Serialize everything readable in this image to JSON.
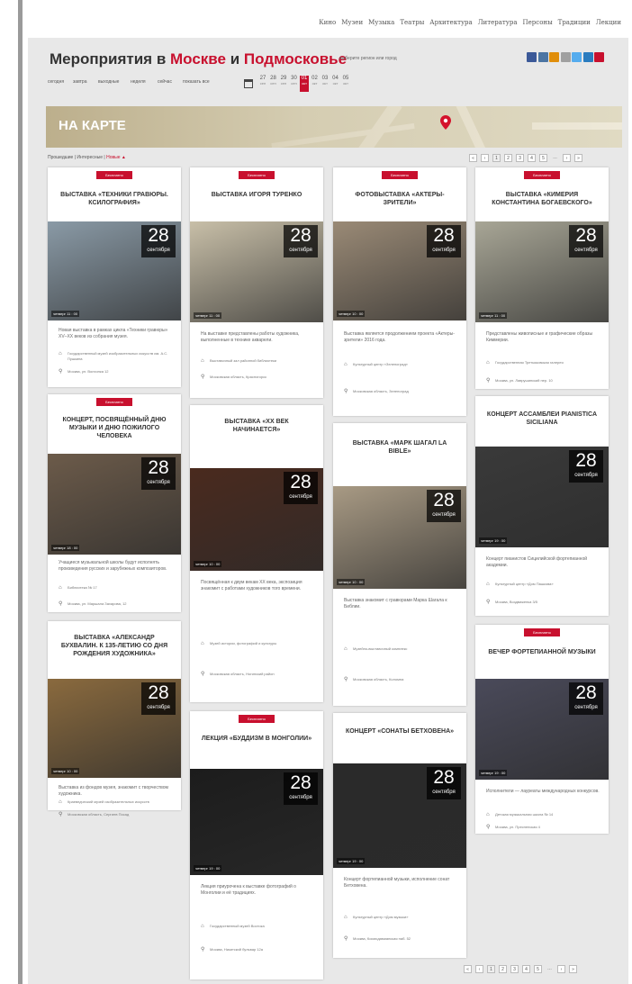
{
  "nav": {
    "items": [
      "Кино",
      "Музеи",
      "Музыка",
      "Театры",
      "Архитектура",
      "Литература",
      "Персоны",
      "Традиции",
      "Лекции"
    ]
  },
  "header": {
    "title_part1": "Мероприятия в",
    "title_city": "Москве",
    "title_and": "и",
    "title_region": "Подмосковье",
    "subtitle": "выберите регион или город"
  },
  "share_colors": [
    "#3b5998",
    "#4c75a3",
    "#e08e0b",
    "#a0a0a0",
    "#55acee",
    "#2a7cbf",
    "#c8102e"
  ],
  "date_bar": {
    "day_links": [
      "сегодня",
      "завтра",
      "выходные",
      "неделя",
      "сейчас",
      "показать все"
    ],
    "dates": [
      {
        "num": "27",
        "mon": "сен"
      },
      {
        "num": "28",
        "mon": "сен"
      },
      {
        "num": "29",
        "mon": "сен"
      },
      {
        "num": "30",
        "mon": "сен"
      },
      {
        "num": "01",
        "mon": "окт"
      },
      {
        "num": "02",
        "mon": "окт"
      },
      {
        "num": "03",
        "mon": "окт"
      },
      {
        "num": "04",
        "mon": "окт"
      },
      {
        "num": "05",
        "mon": "окт"
      }
    ],
    "active_index": 4
  },
  "map_banner": {
    "label": "НА КАРТЕ"
  },
  "filters": {
    "options": [
      "Прошедшие",
      "Интересные",
      "Новые"
    ],
    "active_index": 2
  },
  "pagination": {
    "items": [
      "«",
      "‹",
      "1",
      "2",
      "3",
      "4",
      "5",
      "…",
      "›",
      "»"
    ],
    "active_index": 2
  },
  "columns": [
    [
      {
        "badge": "Бесплатно",
        "title": "Выставка «Техники гравюры. Ксилография»",
        "day": "28",
        "month": "сентября",
        "time": "четверг 11 : 00",
        "desc": "Новая выставка в рамках цикла «Техники гравюры» XV–XX веков из собрания музея.",
        "place": "Государственный музей изобразительных искусств им. А.С. Пушкина",
        "address": "Москва, ул. Волхонка 12",
        "photo": "#8a9aa6"
      },
      {
        "badge": "Бесплатно",
        "title": "Концерт, посвящённый Дню музыки и Дню пожилого человека",
        "day": "28",
        "month": "сентября",
        "time": "четверг 18 : 00",
        "desc": "Учащиеся музыкальной школы будут исполнять произведения русских и зарубежных композиторов.",
        "place": "Библиотека № 17",
        "address": "Москва, ул. Маршала Захарова, 12",
        "photo": "#6c5b4a"
      },
      {
        "badge": "",
        "title": "Выставка «Александр Бухвалин. К 135-летию со дня рождения художника»",
        "day": "28",
        "month": "сентября",
        "time": "четверг 10 : 00",
        "desc": "Выставка из фондов музея, знакомит с творчеством художника.",
        "place": "Краеведческий музей изобразительных искусств",
        "address": "Московская область, Сергиев Посад",
        "photo": "#8a6a3e"
      }
    ],
    [
      {
        "badge": "Бесплатно",
        "title": "Выставка Игоря Туренко",
        "day": "28",
        "month": "сентября",
        "time": "четверг 11 : 00",
        "desc": "На выставке представлены работы художника, выполненные в технике акварели.",
        "place": "Выставочный зал районной библиотеки",
        "address": "Московская область, Красногорск",
        "photo": "#c8bfa8"
      },
      {
        "badge": "",
        "title": "Выставка «XX век начинается»",
        "day": "28",
        "month": "сентября",
        "time": "четверг 10 : 00",
        "desc": "Посвящённая к двум векам XX века, экспозиция знакомит с работами художников того времени.",
        "place": "Музей истории, фотографий и культуры",
        "address": "Московская область, Ногинский район",
        "photo": "#4a2a1e"
      },
      {
        "badge": "Бесплатно",
        "title": "Лекция «Буддизм в Монголии»",
        "day": "28",
        "month": "сентября",
        "time": "четверг 19 : 00",
        "desc": "Лекция приурочена к выставке фотографий о Монголии и её традициях.",
        "place": "Государственный музей Востока",
        "address": "Москва, Никитский бульвар 12а",
        "photo": "#1c1c1c"
      }
    ],
    [
      {
        "badge": "Бесплатно",
        "title": "Фотовыставка «Актеры-зрители»",
        "day": "28",
        "month": "сентября",
        "time": "четверг 10 : 00",
        "desc": "Выставка является продолжением проекта «Актеры-зрители» 2016 года.",
        "place": "Культурный центр «Зеленоград»",
        "address": "Московская область, Зеленоград",
        "photo": "#9a8a76"
      },
      {
        "badge": "",
        "title": "Выставка «Марк Шагал La Bible»",
        "day": "28",
        "month": "сентября",
        "time": "четверг 10 : 00",
        "desc": "Выставка знакомит с гравюрами Марка Шагала к Библии.",
        "place": "Музейно-выставочный комплекс",
        "address": "Московская область, Коломна",
        "photo": "#a89a84"
      },
      {
        "badge": "",
        "title": "Концерт «Сонаты Бетховена»",
        "day": "28",
        "month": "сентября",
        "time": "четверг 19 : 00",
        "desc": "Концерт фортепианной музыки, исполнение сонат Бетховена.",
        "place": "Культурный центр «Дом музыки»",
        "address": "Москва, Космодамианская наб. 52",
        "photo": "#2a2a2a"
      }
    ],
    [
      {
        "badge": "Бесплатно",
        "title": "Выставка «Кимерия Константина Богаевского»",
        "day": "28",
        "month": "сентября",
        "time": "четверг 11 : 00",
        "desc": "Представлены живописные и графические образы Киммерии.",
        "place": "Государственная Третьяковская галерея",
        "address": "Москва, ул. Лаврушинский пер. 10",
        "photo": "#a8a696"
      },
      {
        "badge": "",
        "title": "Концерт Ассамблеи Pianistica Siciliana",
        "day": "28",
        "month": "сентября",
        "time": "четверг 19 : 00",
        "desc": "Концерт пианистов Сицилийской фортепианной академии.",
        "place": "Культурный центр «Дом Пашкова»",
        "address": "Москва, Воздвиженка 3/5",
        "photo": "#3a3a3a"
      },
      {
        "badge": "Бесплатно",
        "title": "Вечер фортепианной музыки",
        "day": "28",
        "month": "сентября",
        "time": "четверг 19 : 00",
        "desc": "Исполнители — лауреаты международных конкурсов.",
        "place": "Детская музыкальная школа № 14",
        "address": "Москва, ул. Пресненская 4",
        "photo": "#4a4a5a"
      }
    ]
  ]
}
